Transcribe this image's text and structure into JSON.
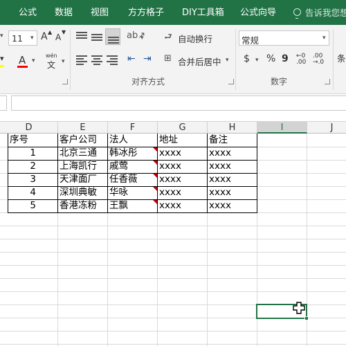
{
  "ribbon_tabs": [
    "公式",
    "数据",
    "视图",
    "方方格子",
    "DIY工具箱",
    "公式向导"
  ],
  "tell_me": "告诉我您想",
  "font": {
    "size": "11",
    "grow_label": "A",
    "shrink_label": "A",
    "font_color_label": "A",
    "pinyin_label": "wén",
    "pinyin_char": "文"
  },
  "alignment": {
    "wrap_text": "自动换行",
    "merge_center": "合并后居中",
    "group_label": "对齐方式"
  },
  "number": {
    "format": "常规",
    "currency_symbol": "$",
    "percent_symbol": "%",
    "comma_symbol": "9",
    "group_label": "数字"
  },
  "styles_partial": "条",
  "columns": [
    "D",
    "E",
    "F",
    "G",
    "H",
    "I",
    "J"
  ],
  "selected_column": "I",
  "table": {
    "headers": [
      "序号",
      "客户公司",
      "法人",
      "地址",
      "备注"
    ],
    "rows": [
      {
        "no": "1",
        "company": "北京三通",
        "person": "韩冰彤",
        "address": "xxxx",
        "note": "xxxx"
      },
      {
        "no": "2",
        "company": "上海凯行",
        "person": "戚莺",
        "address": "xxxx",
        "note": "xxxx"
      },
      {
        "no": "3",
        "company": "天津面厂",
        "person": "任香薇",
        "address": "xxxx",
        "note": "xxxx"
      },
      {
        "no": "4",
        "company": "深圳典敏",
        "person": "华咏",
        "address": "xxxx",
        "note": "xxxx"
      },
      {
        "no": "5",
        "company": "香港冻粉",
        "person": "王飘",
        "address": "xxxx",
        "note": "xxxx"
      }
    ]
  },
  "colors": {
    "ribbon_green": "#217346",
    "comment_indicator": "#c00000",
    "font_color_bar": "#ff0000",
    "highlight_bar": "#ffff00"
  }
}
